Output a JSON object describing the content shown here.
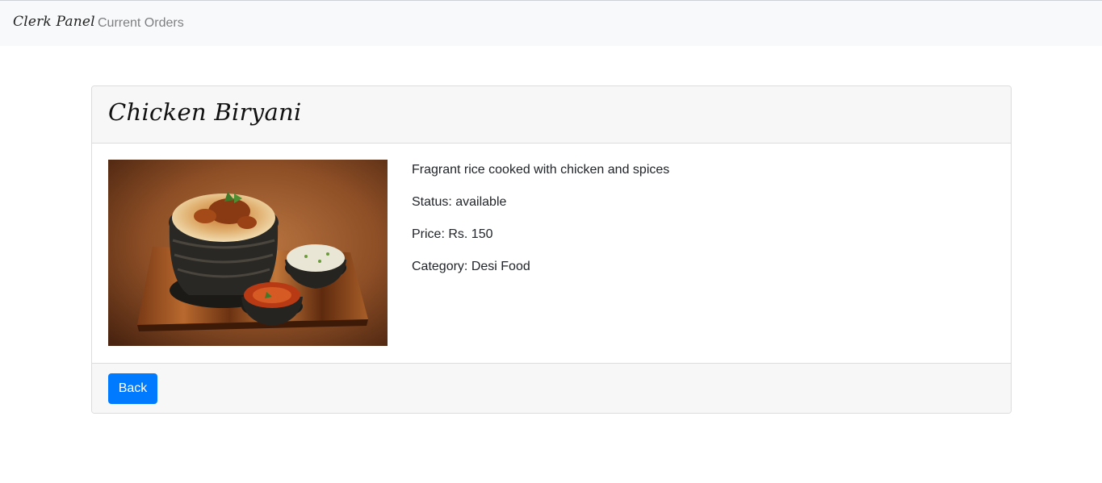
{
  "navbar": {
    "brand": "Clerk Panel",
    "links": [
      {
        "label": "Current Orders"
      }
    ]
  },
  "item": {
    "title": "Chicken Biryani",
    "image_alt": "Chicken biryani in a dark bowl on a wooden board with raita and chutney",
    "description": "Fragrant rice cooked with chicken and spices",
    "status_line": "Status: available",
    "price_line": "Price: Rs. 150",
    "category_line": "Category: Desi Food"
  },
  "footer": {
    "back_label": "Back"
  },
  "colors": {
    "primary": "#007bff",
    "navbar_bg": "#f8f9fa",
    "card_header_bg": "#f7f7f7"
  }
}
